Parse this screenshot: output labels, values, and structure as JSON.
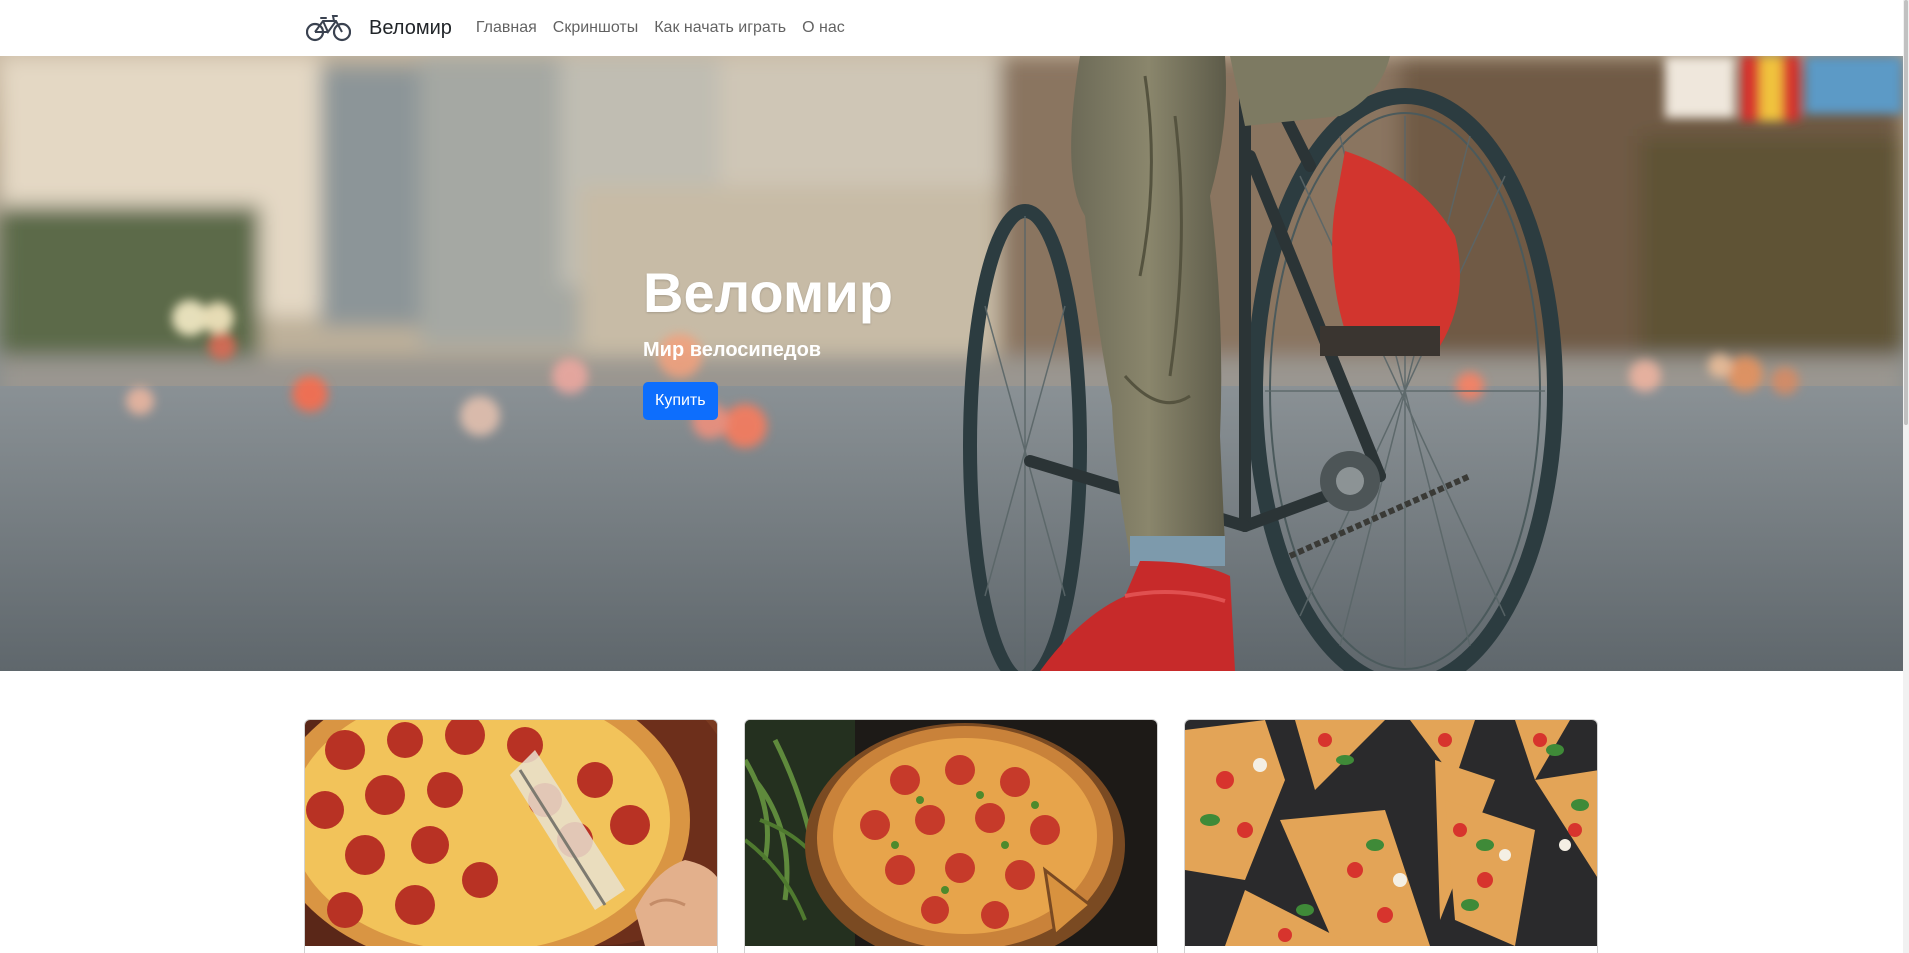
{
  "navbar": {
    "brand_icon": "bicycle-icon",
    "brand": "Веломир",
    "links": [
      {
        "label": "Главная"
      },
      {
        "label": "Скриншоты"
      },
      {
        "label": "Как начать играть"
      },
      {
        "label": "О нас"
      }
    ]
  },
  "hero": {
    "title": "Веломир",
    "subtitle": "Мир велосипедов",
    "button_label": "Купить",
    "button_color": "#0d6efd"
  },
  "cards": [
    {
      "image": "pepperoni-pizza-slice-photo"
    },
    {
      "image": "whole-pepperoni-pizza-photo"
    },
    {
      "image": "margherita-pizza-slices-photo"
    }
  ]
}
